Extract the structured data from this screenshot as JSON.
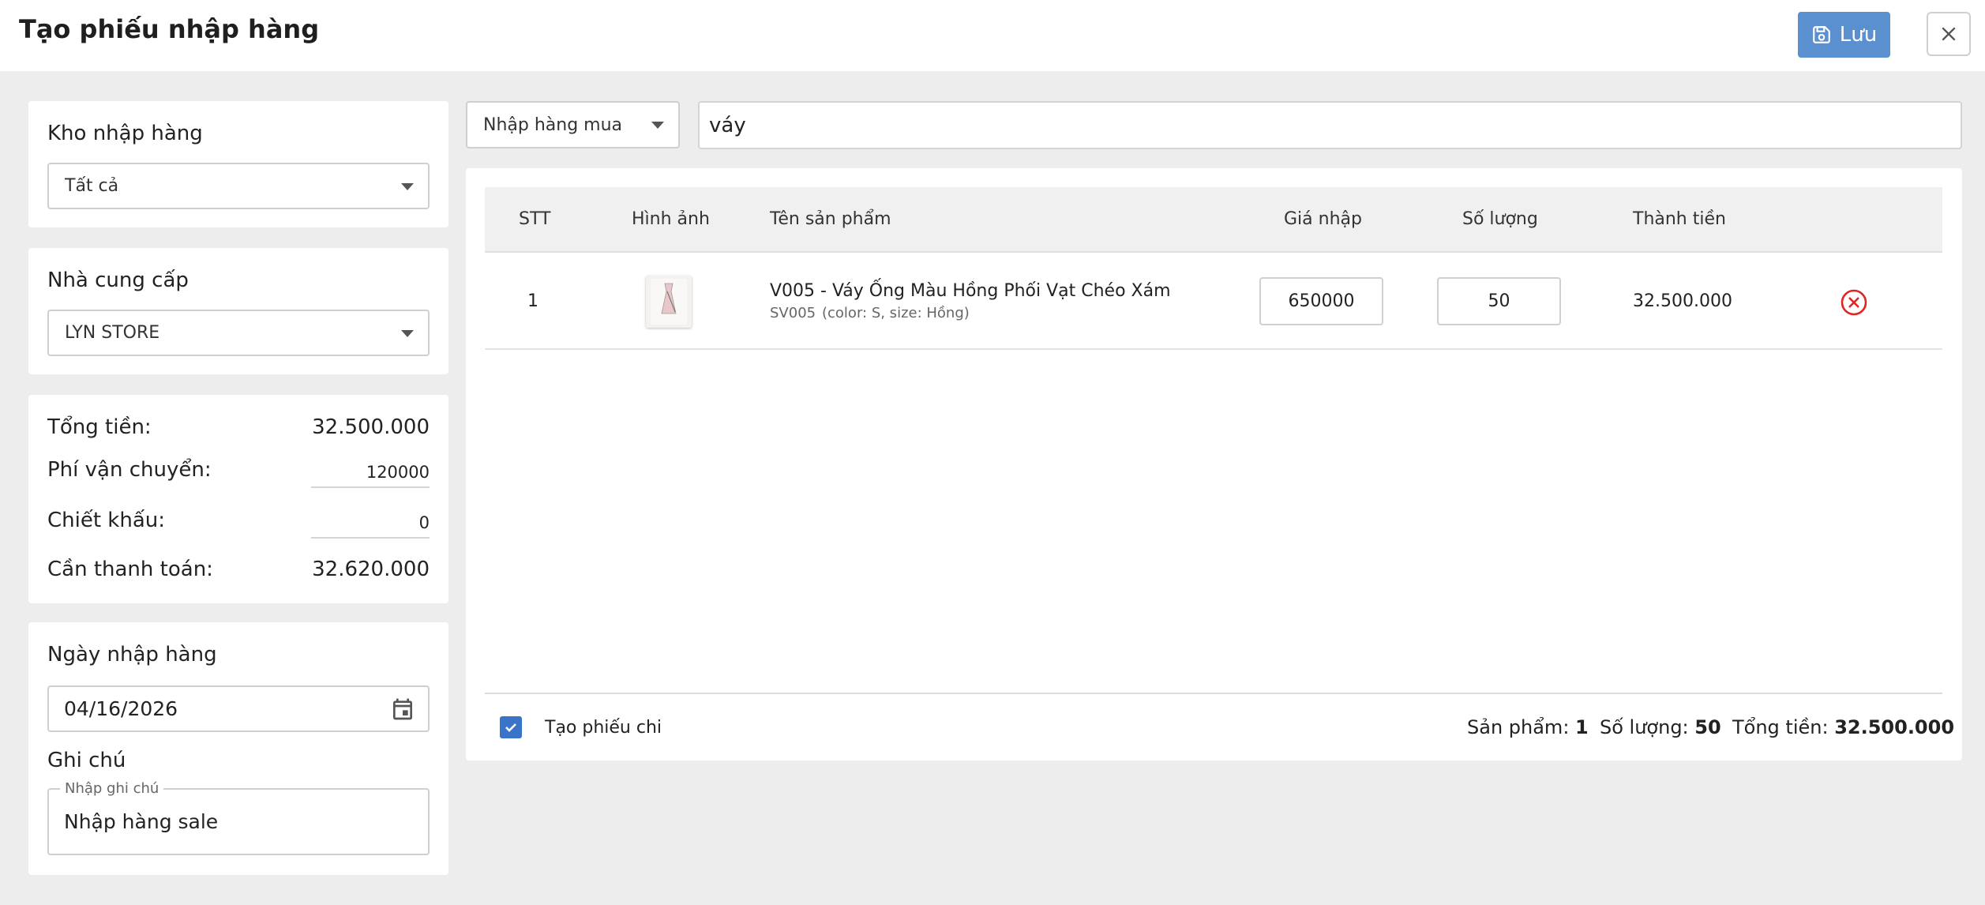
{
  "header": {
    "title": "Tạo phiếu nhập hàng",
    "save_label": "Lưu"
  },
  "sidebar": {
    "warehouse_label": "Kho nhập hàng",
    "warehouse_value": "Tất cả",
    "supplier_label": "Nhà cung cấp",
    "supplier_value": "LYN STORE",
    "summary": {
      "total_label": "Tổng tiền:",
      "total_value": "32.500.000",
      "shipping_label": "Phí vận chuyển:",
      "shipping_value": "120000",
      "discount_label": "Chiết khấu:",
      "discount_value": "0",
      "payable_label": "Cần thanh toán:",
      "payable_value": "32.620.000"
    },
    "date_label": "Ngày nhập hàng",
    "date_value": "04/16/2026",
    "note_label": "Ghi chú",
    "note_placeholder": "Nhập ghi chú",
    "note_value": "Nhập hàng sale"
  },
  "toolbar": {
    "type_value": "Nhập hàng mua",
    "search_value": "váy"
  },
  "table": {
    "headers": [
      "STT",
      "Hình ảnh",
      "Tên sản phẩm",
      "Giá nhập",
      "Số lượng",
      "Thành tiền"
    ],
    "rows": [
      {
        "index": "1",
        "name": "V005 - Váy Ống Màu Hồng Phối Vạt Chéo Xám",
        "sku": "SV005",
        "variant": "(color: S, size: Hồng)",
        "price": "650000",
        "quantity": "50",
        "amount": "32.500.000"
      }
    ]
  },
  "footer": {
    "create_receipt_label": "Tạo phiếu chi",
    "products_label": "Sản phẩm:",
    "products_value": "1",
    "quantity_label": "Số lượng:",
    "quantity_value": "50",
    "total_label": "Tổng tiền:",
    "total_value": "32.500.000"
  },
  "colors": {
    "primary": "#5a8fd0",
    "checkbox": "#3a74c8",
    "danger": "#e02424",
    "background": "#ededed"
  }
}
